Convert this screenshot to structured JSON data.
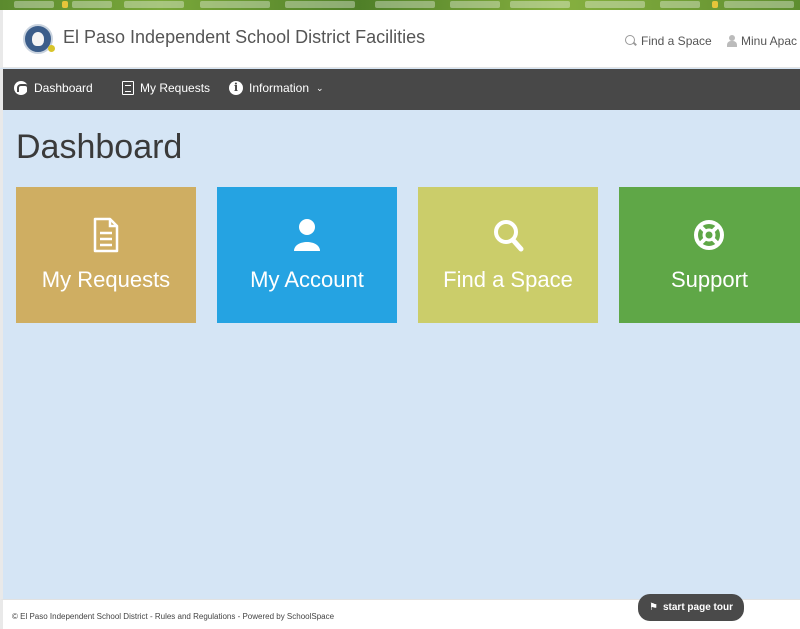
{
  "browser": {
    "bookmark_bar": "browser-bookmarks"
  },
  "header": {
    "title": "El Paso Independent School District Facilities",
    "find_space": "Find a Space",
    "user": "Minu Apac"
  },
  "nav": {
    "items": [
      {
        "label": "Dashboard",
        "icon": "dashboard-icon"
      },
      {
        "label": "My Requests",
        "icon": "document-icon"
      },
      {
        "label": "Information",
        "icon": "info-icon",
        "chevron": "⌄"
      }
    ]
  },
  "main": {
    "title": "Dashboard",
    "tiles": [
      {
        "label": "My Requests",
        "icon": "document-icon",
        "color": "#cfae62"
      },
      {
        "label": "My Account",
        "icon": "user-icon",
        "color": "#25a3e2"
      },
      {
        "label": "Find a Space",
        "icon": "search-icon",
        "color": "#cbcd6a"
      },
      {
        "label": "Support",
        "icon": "lifebuoy-icon",
        "color": "#5fa747"
      }
    ]
  },
  "footer": {
    "text": "© El Paso Independent School District - Rules and Regulations - Powered by SchoolSpace",
    "tour_button": "start page tour",
    "tour_icon": "flag-icon"
  },
  "colors": {
    "nav_bg": "#484848",
    "page_bg": "#d5e5f5"
  }
}
